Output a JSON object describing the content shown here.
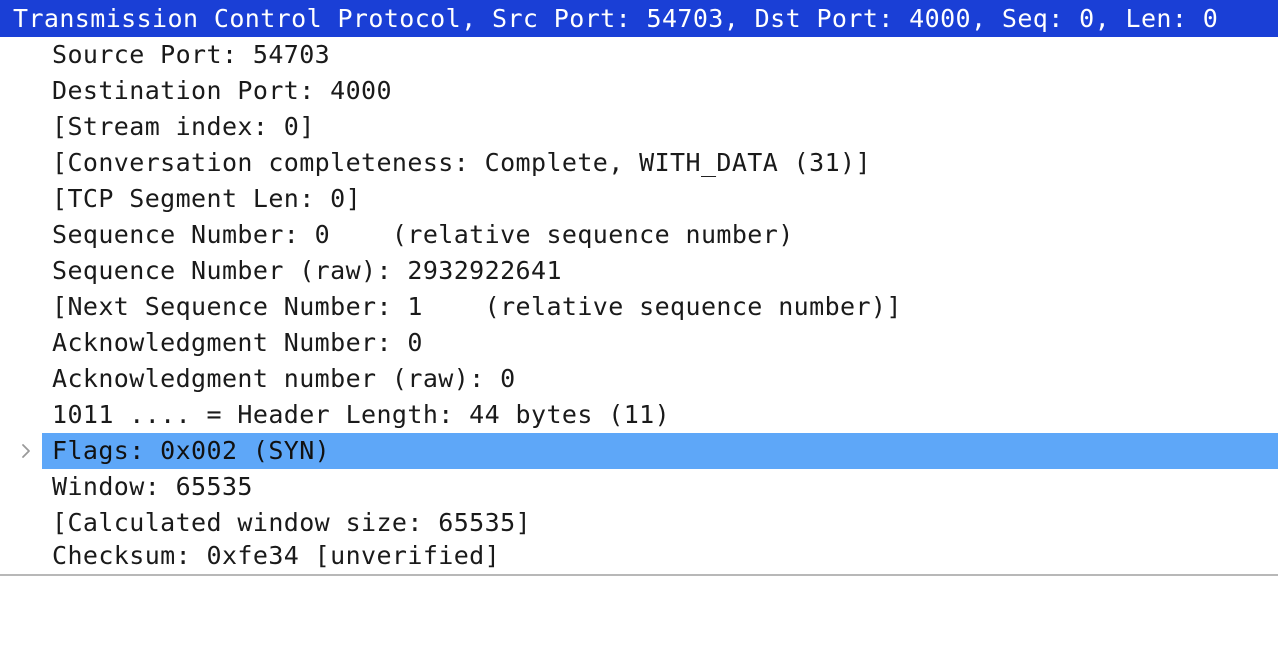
{
  "header": {
    "label": "Transmission Control Protocol, Src Port: 54703, Dst Port: 4000, Seq: 0, Len: 0"
  },
  "fields": [
    {
      "label": "Source Port: 54703"
    },
    {
      "label": "Destination Port: 4000"
    },
    {
      "label": "[Stream index: 0]"
    },
    {
      "label": "[Conversation completeness: Complete, WITH_DATA (31)]"
    },
    {
      "label": "[TCP Segment Len: 0]"
    },
    {
      "label": "Sequence Number: 0    (relative sequence number)"
    },
    {
      "label": "Sequence Number (raw): 2932922641"
    },
    {
      "label": "[Next Sequence Number: 1    (relative sequence number)]"
    },
    {
      "label": "Acknowledgment Number: 0"
    },
    {
      "label": "Acknowledgment number (raw): 0"
    },
    {
      "label": "1011 .... = Header Length: 44 bytes (11)"
    },
    {
      "label": "Flags: 0x002 (SYN)"
    },
    {
      "label": "Window: 65535"
    },
    {
      "label": "[Calculated window size: 65535]"
    },
    {
      "label": "Checksum: 0xfe34 [unverified]"
    }
  ],
  "selected_index": 11,
  "icons": {
    "flags_expander": "chevron-right-icon"
  },
  "colors": {
    "header_highlight": "#1a3fd6",
    "selection_highlight": "#5ea7f8"
  }
}
